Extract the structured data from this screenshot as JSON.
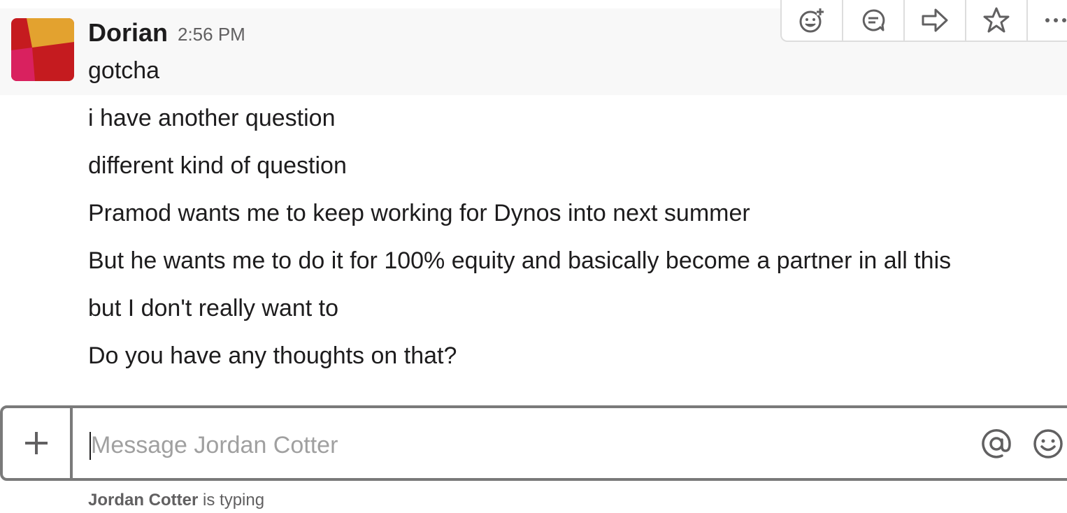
{
  "message": {
    "author": "Dorian",
    "timestamp": "2:56 PM",
    "avatar_colors": [
      "#e3a22f",
      "#d9215f",
      "#c51b1f"
    ],
    "lines": [
      "gotcha",
      "i have another question",
      "different kind of question",
      "Pramod wants me to keep working for Dynos into next summer",
      "But he wants me to do it for 100% equity and basically become a partner in all this",
      "but I don't really want to",
      "Do you have any thoughts on that?"
    ]
  },
  "message_actions": [
    {
      "icon": "add-reaction-icon"
    },
    {
      "icon": "start-thread-icon"
    },
    {
      "icon": "share-message-icon"
    },
    {
      "icon": "star-icon"
    },
    {
      "icon": "more-actions-icon"
    }
  ],
  "composer": {
    "placeholder": "Message Jordan Cotter",
    "attach_icon": "plus-icon",
    "mention_icon": "at-icon",
    "emoji_icon": "emoji-icon"
  },
  "typing": {
    "name": "Jordan Cotter",
    "text": "is typing"
  },
  "colors": {
    "text": "#1d1c1d",
    "muted": "#616061",
    "hover_background": "#f8f8f8",
    "composer_border": "#7a7a7a"
  }
}
